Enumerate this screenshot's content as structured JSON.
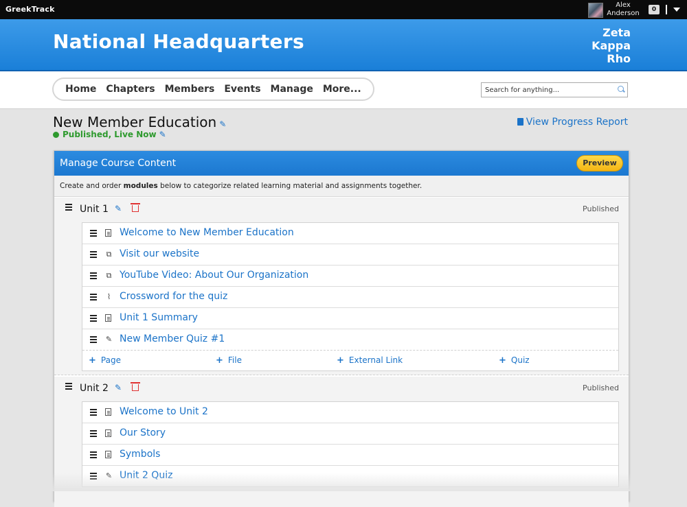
{
  "topbar": {
    "brand": "GreekTrack",
    "user_name": "Alex Anderson",
    "notifications": "0"
  },
  "header": {
    "title": "National Headquarters",
    "letters": [
      "Zeta",
      "Kappa",
      "Rho"
    ]
  },
  "nav": {
    "items": [
      "Home",
      "Chapters",
      "Members",
      "Events",
      "Manage",
      "More..."
    ],
    "search_placeholder": "Search for anything..."
  },
  "page": {
    "title": "New Member Education",
    "status": "Published, Live Now",
    "progress_link": "View Progress Report"
  },
  "panel": {
    "title": "Manage Course Content",
    "preview_label": "Preview",
    "desc_pre": "Create and order ",
    "desc_bold": "modules",
    "desc_post": " below to categorize related learning material and assignments together.",
    "add_labels": [
      "Page",
      "File",
      "External Link",
      "Quiz"
    ],
    "units": [
      {
        "title": "Unit 1",
        "status": "Published",
        "items": [
          {
            "label": "Welcome to New Member Education",
            "icon": "document-icon"
          },
          {
            "label": "Visit our website",
            "icon": "external-link-icon"
          },
          {
            "label": "YouTube Video: About Our Organization",
            "icon": "external-link-icon"
          },
          {
            "label": "Crossword for the quiz",
            "icon": "paperclip-icon"
          },
          {
            "label": "Unit 1 Summary",
            "icon": "document-icon"
          },
          {
            "label": "New Member Quiz #1",
            "icon": "quiz-edit-icon"
          }
        ]
      },
      {
        "title": "Unit 2",
        "status": "Published",
        "items": [
          {
            "label": "Welcome to Unit 2",
            "icon": "document-icon"
          },
          {
            "label": "Our Story",
            "icon": "document-icon"
          },
          {
            "label": "Symbols",
            "icon": "document-icon"
          },
          {
            "label": "Unit 2 Quiz",
            "icon": "quiz-edit-icon"
          }
        ]
      }
    ]
  },
  "colors": {
    "accent": "#1b73c8",
    "header_blue": "#1a7fd8",
    "status_green": "#2e9a2e",
    "delete_red": "#e03030",
    "preview_yellow": "#f3b514"
  }
}
